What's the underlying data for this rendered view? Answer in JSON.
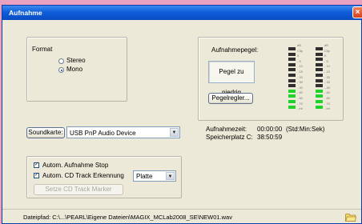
{
  "window": {
    "title": "Aufnahme",
    "close_glyph": "×"
  },
  "format": {
    "label": "Format",
    "options": [
      {
        "label": "Stereo",
        "selected": false
      },
      {
        "label": "Mono",
        "selected": true
      }
    ]
  },
  "level": {
    "label": "Aufnahmepegel:",
    "status": "Pegel zu niedrig",
    "button_label": "Pegelregler...",
    "scale_labels": [
      "dB",
      "Clip",
      "0",
      "- 5",
      "- 10",
      "- 15",
      "- 20",
      "- 30",
      "- 40",
      "- 50",
      "- 60",
      "- 70",
      "- inf"
    ],
    "meter_colors": {
      "on": "#1fd32a",
      "off": "#2f2f2f",
      "background": "#ffffff"
    },
    "meters": [
      {
        "channel": "left",
        "level_db": -50
      },
      {
        "channel": "right",
        "level_db": -50
      }
    ]
  },
  "soundcard": {
    "button_label": "Soundkarte:",
    "selected": "USB PnP Audio Device"
  },
  "recording_info": {
    "time_label": "Aufnahmezeit:",
    "time_value": "00:00:00",
    "time_unit": "(Std:Min:Sek)",
    "space_label": "Speicherplatz C:",
    "space_value": "38:50:59"
  },
  "options": {
    "auto_stop_label": "Autom. Aufnahme Stop",
    "auto_stop_checked": true,
    "cd_track_label": "Autom. CD Track Erkennung",
    "cd_track_checked": true,
    "cd_track_mode": "Platte",
    "set_marker_label": "Setze CD Track Marker"
  },
  "footer": {
    "file_path": "Dateipfad: C:\\...\\PEARL\\Eigene Dateien\\MAGIX_MCLab2008_SE\\NEW01.wav",
    "folder_icon": "folder-icon"
  },
  "colors": {
    "titlebar": "#0f5ed9",
    "window": "#ece9d8",
    "desktop": "#e8a2bf"
  }
}
